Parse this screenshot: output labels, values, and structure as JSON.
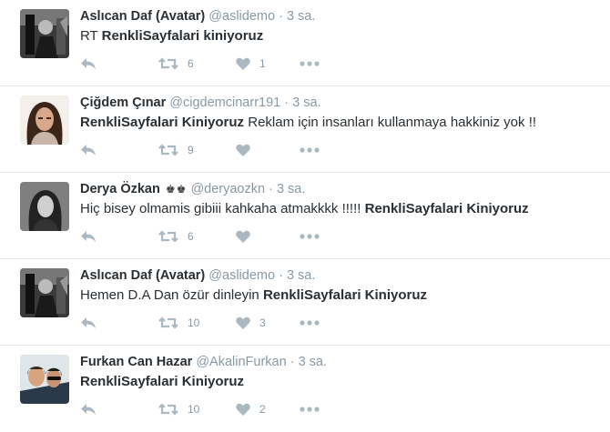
{
  "tweets": [
    {
      "name": "Aslıcan Daf (Avatar)",
      "badges": "",
      "handle": "@aslidemo",
      "time": "3 sa.",
      "text_before": "RT ",
      "text_bold": "RenkliSayfalari kiniyoruz",
      "text_after": "",
      "retweets": "6",
      "likes": "1",
      "avatar_icon": "avatar-bw-photo"
    },
    {
      "name": "Çiğdem Çınar",
      "badges": "",
      "handle": "@cigdemcinarr191",
      "time": "3 sa.",
      "text_before": "",
      "text_bold": "RenkliSayfalari Kiniyoruz",
      "text_after": " Reklam için insanları kullanmaya hakkiniz yok !!",
      "retweets": "9",
      "likes": "",
      "avatar_icon": "avatar-woman-portrait"
    },
    {
      "name": "Derya Özkan",
      "badges": "♚♚",
      "handle": "@deryaozkn",
      "time": "3 sa.",
      "text_before": "Hiç bisey olmamis gibiii kahkaha atmakkkk !!!!! ",
      "text_bold": "RenkliSayfalari Kiniyoruz",
      "text_after": "",
      "retweets": "6",
      "likes": "",
      "avatar_icon": "avatar-bw-portrait"
    },
    {
      "name": "Aslıcan Daf (Avatar)",
      "badges": "",
      "handle": "@aslidemo",
      "time": "3 sa.",
      "text_before": "Hemen D.A Dan özür dinleyin ",
      "text_bold": "RenkliSayfalari Kiniyoruz",
      "text_after": "",
      "retweets": "10",
      "likes": "3",
      "avatar_icon": "avatar-bw-photo"
    },
    {
      "name": "Furkan Can Hazar",
      "badges": "",
      "handle": "@AkalinFurkan",
      "time": "3 sa.",
      "text_before": "",
      "text_bold": "RenkliSayfalari Kiniyoruz",
      "text_after": "",
      "retweets": "10",
      "likes": "2",
      "avatar_icon": "avatar-couple-photo"
    }
  ],
  "separator": "·",
  "colors": {
    "name": "#292f33",
    "meta": "#8899a6",
    "icon": "#aab8c2",
    "border": "#e1e8ed"
  }
}
